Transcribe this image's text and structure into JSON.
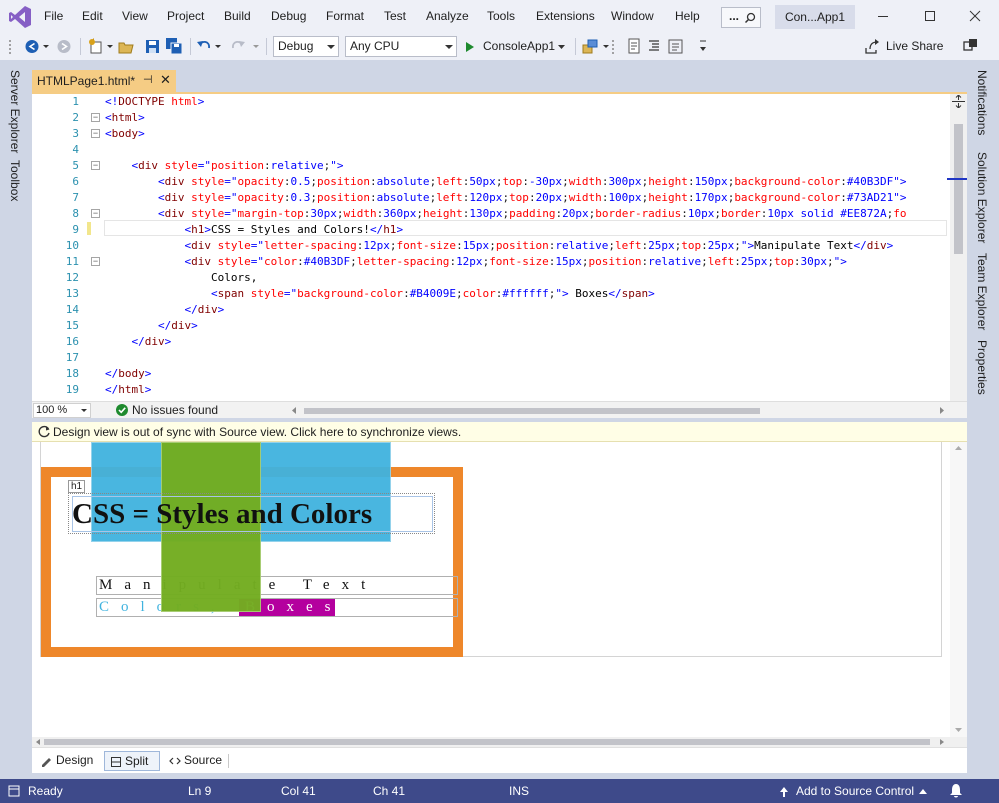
{
  "menu": {
    "items": [
      "File",
      "Edit",
      "View",
      "Project",
      "Build",
      "Debug",
      "Format",
      "Test",
      "Analyze",
      "Tools",
      "Extensions",
      "Window",
      "Help"
    ],
    "search_label": "...",
    "solution_title": "Con...App1"
  },
  "toolbar": {
    "configuration": "Debug",
    "platform": "Any CPU",
    "run_target": "ConsoleApp1",
    "live_share": "Live Share"
  },
  "left_rail": [
    "Server Explorer",
    "Toolbox"
  ],
  "right_rail": [
    "Notifications",
    "Solution Explorer",
    "Team Explorer",
    "Properties"
  ],
  "document_tab": {
    "name": "HTMLPage1.html*",
    "pin": "⊣",
    "close": "✕"
  },
  "editor": {
    "line_numbers": [
      "1",
      "2",
      "3",
      "4",
      "5",
      "6",
      "7",
      "8",
      "9",
      "10",
      "11",
      "12",
      "13",
      "14",
      "15",
      "16",
      "17",
      "18",
      "19"
    ]
  },
  "editor_status": {
    "zoom": "100 %",
    "issues": "No issues found"
  },
  "design": {
    "sync_message": "Design view is out of sync with Source view. Click here to synchronize views.",
    "h1_tag": "h1",
    "h1_text": "CSS = Styles and Colors",
    "row1_text": "Manipulate Text",
    "row2_text": "Colors,",
    "row2_highlight": "Boxes",
    "colors": {
      "blue": "#40B3DF",
      "green": "#73AD21",
      "border": "#EE872A",
      "highlight": "#B4009E"
    }
  },
  "view_tabs": {
    "design": "Design",
    "split": "Split",
    "source": "Source"
  },
  "statusbar": {
    "ready": "Ready",
    "line": "Ln 9",
    "col": "Col 41",
    "ch": "Ch 41",
    "mode": "INS",
    "source_control": "Add to Source Control"
  }
}
